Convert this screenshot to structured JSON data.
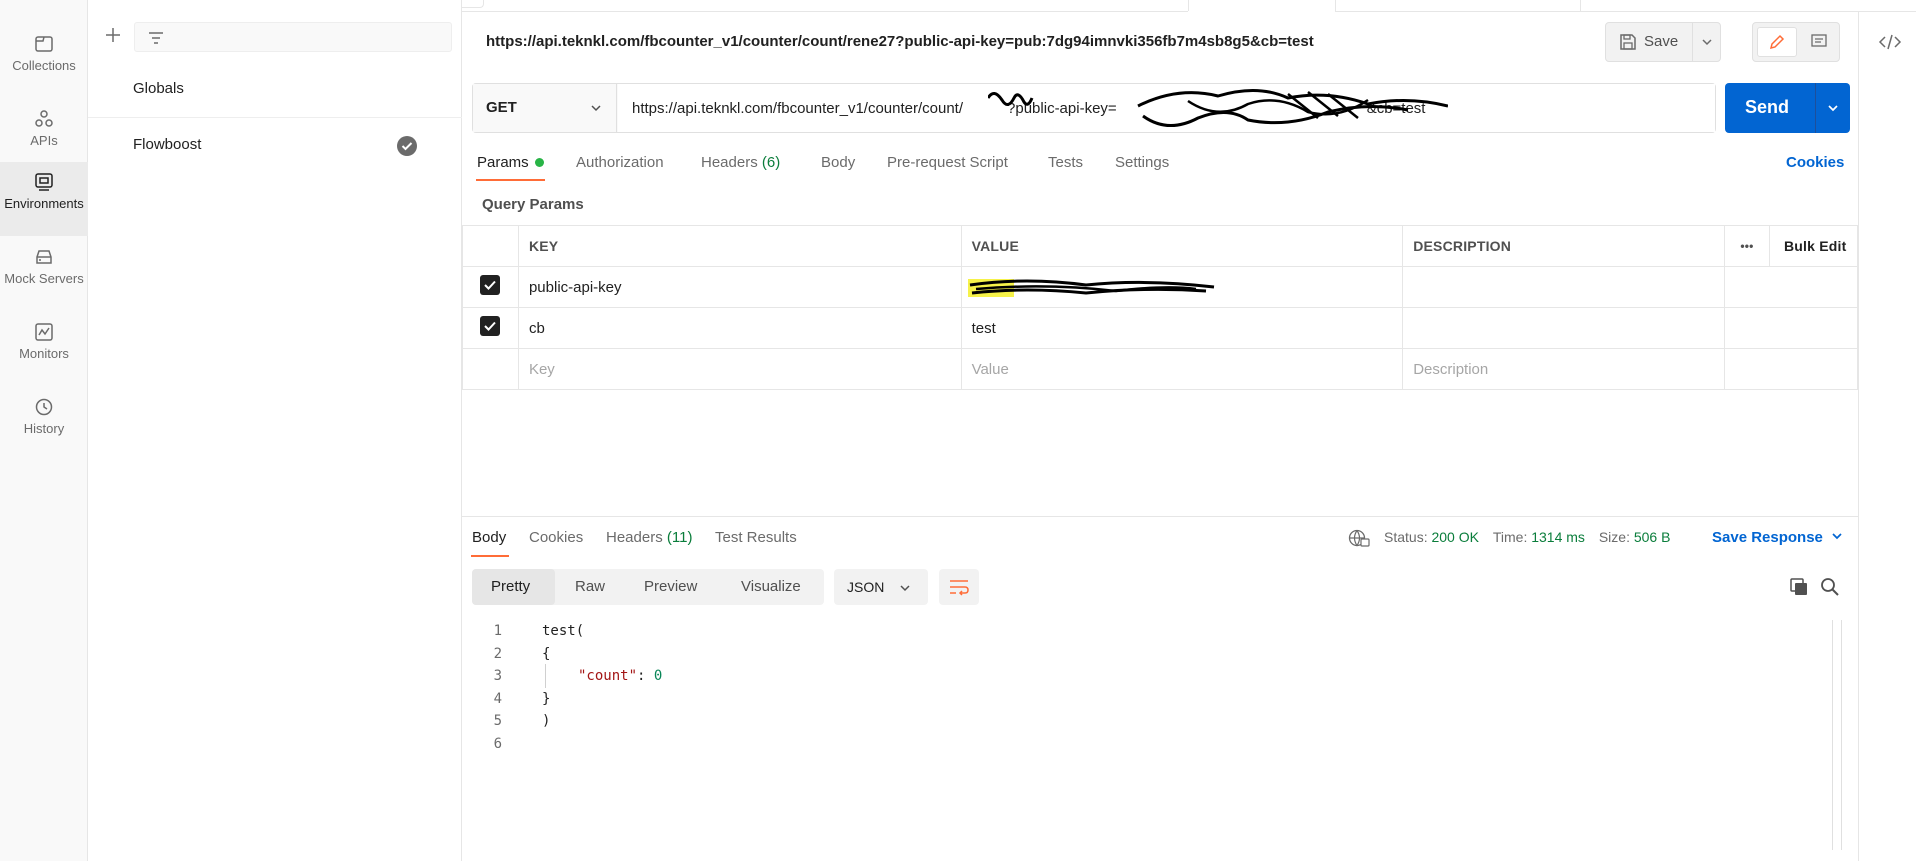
{
  "nav": {
    "items": [
      {
        "label": "Collections",
        "icon": "collections-icon"
      },
      {
        "label": "APIs",
        "icon": "apis-icon"
      },
      {
        "label": "Environments",
        "icon": "environments-icon"
      },
      {
        "label": "Mock Servers",
        "icon": "mock-servers-icon"
      },
      {
        "label": "Monitors",
        "icon": "monitors-icon"
      },
      {
        "label": "History",
        "icon": "history-icon"
      }
    ]
  },
  "sidebar": {
    "items": [
      {
        "label": "Globals"
      },
      {
        "label": "Flowboost"
      }
    ]
  },
  "request": {
    "title_url": "https://api.teknkl.com/fbcounter_v1/counter/count/rene27?public-api-key=pub:7dg94imnvki356fb7m4sb8g5&cb=test",
    "save_label": "Save",
    "method": "GET",
    "url_prefix": "https://api.teknkl.com/fbcounter_v1/counter/count/",
    "url_mid": "?public-api-key=",
    "url_suffix": "&cb=test",
    "send_label": "Send",
    "tabs": [
      {
        "label": "Params"
      },
      {
        "label": "Authorization"
      },
      {
        "label": "Headers",
        "count": "(6)"
      },
      {
        "label": "Body"
      },
      {
        "label": "Pre-request Script"
      },
      {
        "label": "Tests"
      },
      {
        "label": "Settings"
      }
    ],
    "cookies_label": "Cookies",
    "query_params_label": "Query Params",
    "table": {
      "headers": {
        "key": "KEY",
        "value": "VALUE",
        "description": "DESCRIPTION",
        "bulk_edit": "Bulk Edit",
        "more": "•••"
      },
      "rows": [
        {
          "key": "public-api-key",
          "value": "",
          "description": ""
        },
        {
          "key": "cb",
          "value": "test",
          "description": ""
        }
      ],
      "placeholders": {
        "key": "Key",
        "value": "Value",
        "description": "Description"
      }
    }
  },
  "response": {
    "tabs": [
      {
        "label": "Body"
      },
      {
        "label": "Cookies"
      },
      {
        "label": "Headers",
        "count": "(11)"
      },
      {
        "label": "Test Results"
      }
    ],
    "status_label": "Status:",
    "status_value": "200 OK",
    "time_label": "Time:",
    "time_value": "1314 ms",
    "size_label": "Size:",
    "size_value": "506 B",
    "save_response_label": "Save Response",
    "view_tabs": [
      {
        "label": "Pretty"
      },
      {
        "label": "Raw"
      },
      {
        "label": "Preview"
      },
      {
        "label": "Visualize"
      }
    ],
    "format": "JSON",
    "code_lines": [
      {
        "n": "1",
        "text": "test("
      },
      {
        "n": "2",
        "text": "{"
      },
      {
        "n": "3",
        "key": "\"count\"",
        "sep": ": ",
        "val": "0"
      },
      {
        "n": "4",
        "text": "}"
      },
      {
        "n": "5",
        "text": ")"
      },
      {
        "n": "6",
        "text": ""
      }
    ]
  },
  "colors": {
    "accent": "#ff6c37",
    "primary": "#0265d2",
    "success": "#0a7d3b",
    "green_dot": "#28b446"
  }
}
